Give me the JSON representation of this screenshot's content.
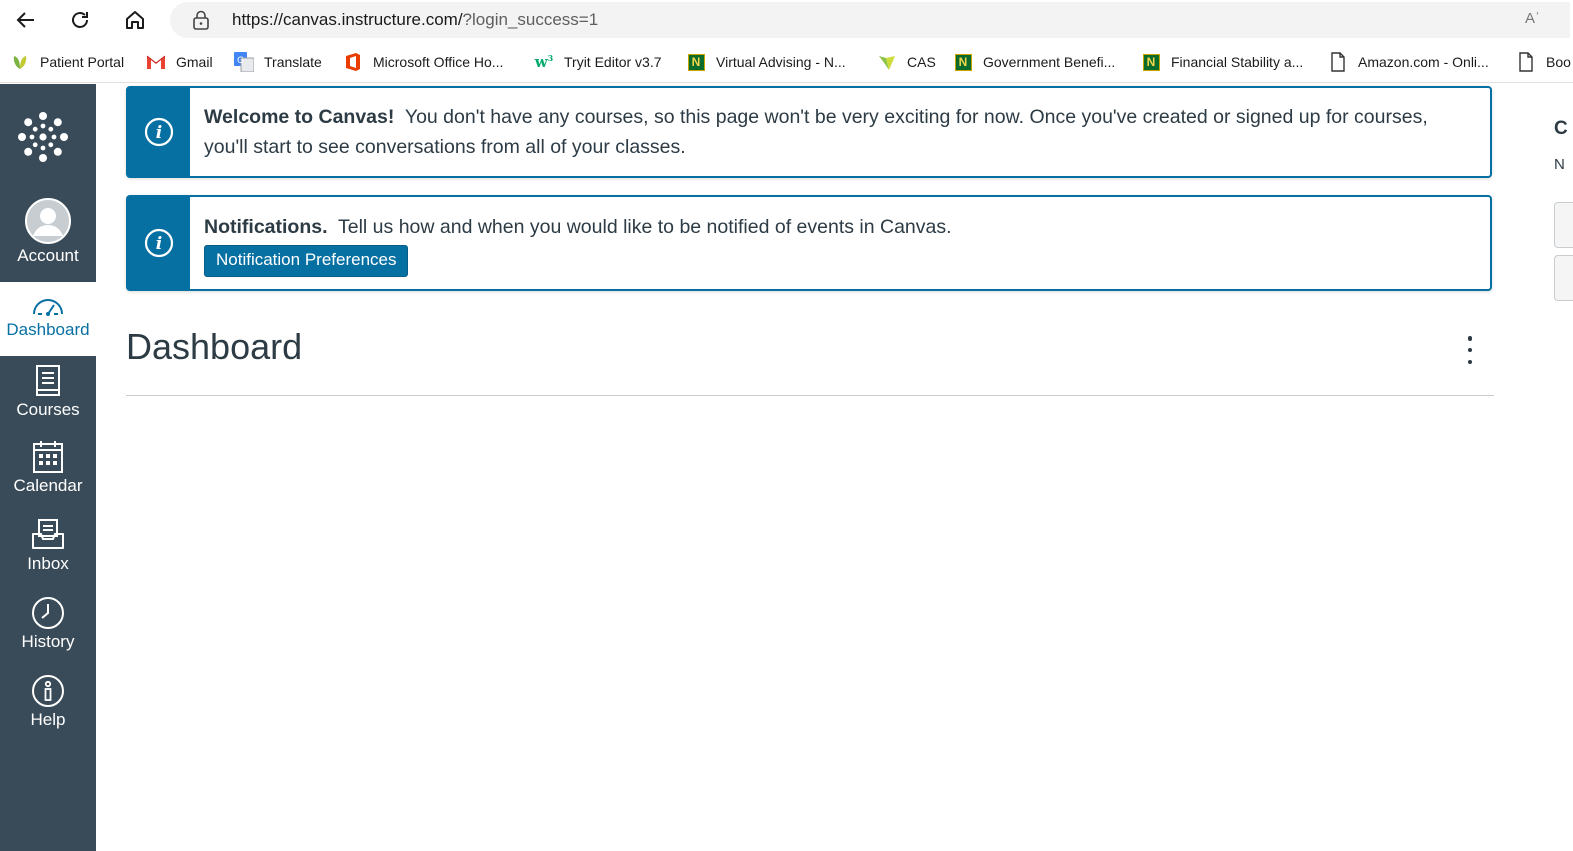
{
  "browser": {
    "url_host": "https://canvas.instructure.com/",
    "url_rest": "?login_success=1",
    "read_aloud": "Aʾ"
  },
  "bookmarks": [
    {
      "label": "Patient Portal",
      "icon": "leaf-icon"
    },
    {
      "label": "Gmail",
      "icon": "gmail-icon"
    },
    {
      "label": "Translate",
      "icon": "translate-icon"
    },
    {
      "label": "Microsoft Office Ho...",
      "icon": "office-icon"
    },
    {
      "label": "Tryit Editor v3.7",
      "icon": "w3schools-icon"
    },
    {
      "label": "Virtual Advising - N...",
      "icon": "n-logo-icon"
    },
    {
      "label": "CAS",
      "icon": "cas-icon"
    },
    {
      "label": "Government Benefi...",
      "icon": "n-logo-icon"
    },
    {
      "label": "Financial Stability a...",
      "icon": "n-logo-icon"
    },
    {
      "label": "Amazon.com - Onli...",
      "icon": "page-icon"
    },
    {
      "label": "Boo",
      "icon": "page-icon"
    }
  ],
  "sidebar": {
    "items": [
      {
        "label": "Account",
        "icon": "avatar-icon"
      },
      {
        "label": "Dashboard",
        "icon": "dashboard-icon"
      },
      {
        "label": "Courses",
        "icon": "courses-icon"
      },
      {
        "label": "Calendar",
        "icon": "calendar-icon"
      },
      {
        "label": "Inbox",
        "icon": "inbox-icon"
      },
      {
        "label": "History",
        "icon": "clock-icon"
      },
      {
        "label": "Help",
        "icon": "help-icon"
      }
    ]
  },
  "alerts": {
    "welcome_title": "Welcome to Canvas!",
    "welcome_body": "You don't have any courses, so this page won't be very exciting for now. Once you've created or signed up for courses, you'll start to see conversations from all of your classes.",
    "notif_title": "Notifications.",
    "notif_body": "Tell us how and when you would like to be notified of events in Canvas.",
    "notif_button": "Notification Preferences"
  },
  "main": {
    "title": "Dashboard"
  },
  "right_fragment": {
    "line1": "C",
    "line2": "N"
  },
  "colors": {
    "sidebar_bg": "#394b58",
    "brand_blue": "#0770a3"
  }
}
